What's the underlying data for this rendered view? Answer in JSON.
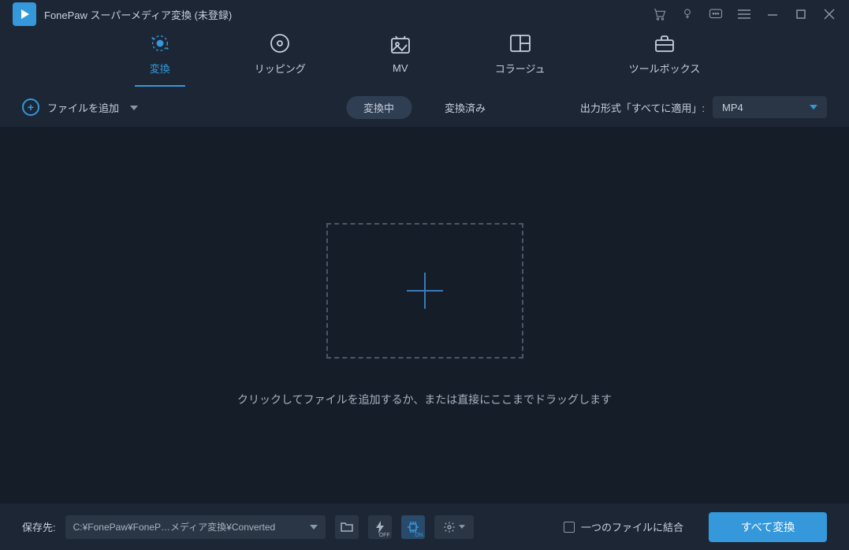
{
  "titlebar": {
    "app_title": "FonePaw スーパーメディア変換 (未登録)"
  },
  "nav": {
    "items": [
      {
        "label": "変換"
      },
      {
        "label": "リッピング"
      },
      {
        "label": "MV"
      },
      {
        "label": "コラージュ"
      },
      {
        "label": "ツールボックス"
      }
    ]
  },
  "toolbar": {
    "add_file_label": "ファイルを追加",
    "tab_converting": "変換中",
    "tab_converted": "変換済み",
    "output_label": "出力形式「すべてに適用」:",
    "output_format": "MP4"
  },
  "main": {
    "drop_hint": "クリックしてファイルを追加するか、または直接にここまでドラッグします"
  },
  "bottom": {
    "save_label": "保存先:",
    "save_path": "C:¥FonePaw¥FoneP…メディア変換¥Converted",
    "lightning_state": "OFF",
    "gpu_state": "ON",
    "merge_label": "一つのファイルに結合",
    "convert_all": "すべて変換"
  }
}
